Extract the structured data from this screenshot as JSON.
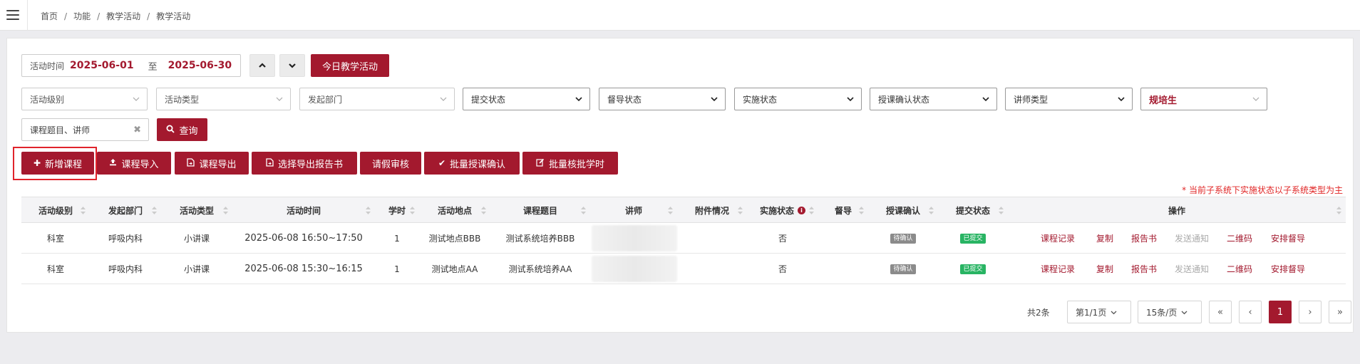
{
  "breadcrumb": [
    "首页",
    "功能",
    "教学活动",
    "教学活动"
  ],
  "filters": {
    "date_label": "活动时间",
    "date_start": "2025-06-01",
    "date_to": "至",
    "date_end": "2025-06-30",
    "today_button": "今日教学活动",
    "selects": [
      "活动级别",
      "活动类型",
      "发起部门",
      "提交状态",
      "督导状态",
      "实施状态",
      "授课确认状态",
      "讲师类型",
      "规培生"
    ],
    "search_placeholder": "课程题目、讲师",
    "query_button": "查询"
  },
  "toolbar": [
    "新增课程",
    "课程导入",
    "课程导出",
    "选择导出报告书",
    "请假审核",
    "批量授课确认",
    "批量核批学时"
  ],
  "note": "* 当前子系统下实施状态以子系统类型为主",
  "table": {
    "headers": [
      "活动级别",
      "发起部门",
      "活动类型",
      "活动时间",
      "学时",
      "活动地点",
      "课程题目",
      "讲师",
      "附件情况",
      "实施状态",
      "督导",
      "授课确认",
      "提交状态",
      "操作"
    ],
    "rows": [
      {
        "level": "科室",
        "dept": "呼吸内科",
        "type": "小讲课",
        "time": "2025-06-08  16:50~17:50",
        "hours": "1",
        "place": "测试地点BBB",
        "course": "测试系统培养BBB",
        "teacher": "",
        "attach": "",
        "status": "否",
        "supervise": "",
        "confirm": "待确认",
        "submit": "已提交"
      },
      {
        "level": "科室",
        "dept": "呼吸内科",
        "type": "小讲课",
        "time": "2025-06-08  15:30~16:15",
        "hours": "1",
        "place": "测试地点AA",
        "course": "测试系统培养AA",
        "teacher": "",
        "attach": "",
        "status": "否",
        "supervise": "",
        "confirm": "待确认",
        "submit": "已提交"
      }
    ],
    "ops": [
      "课程记录",
      "复制",
      "报告书",
      "发送通知",
      "二维码",
      "安排督导"
    ]
  },
  "pagination": {
    "total": "共2条",
    "page_info": "第1/1页",
    "page_size": "15条/页",
    "first": "«",
    "prev": "‹",
    "current": "1",
    "next": "›",
    "last": "»"
  }
}
